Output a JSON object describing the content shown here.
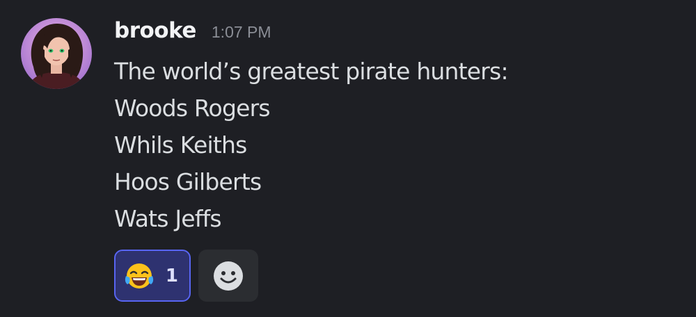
{
  "message": {
    "author": "brooke",
    "timestamp": "1:07 PM",
    "lines": [
      "The world’s greatest pirate hunters:",
      "Woods Rogers",
      "Whils Keiths",
      "Hoos Gilberts",
      "Wats Jeffs"
    ],
    "avatar_icon": "user-avatar"
  },
  "reactions": [
    {
      "emoji": "😂",
      "icon": "face-with-tears-of-joy-icon",
      "count": "1",
      "active": true
    }
  ],
  "add_reaction": {
    "icon": "smiley-face-icon"
  },
  "colors": {
    "background": "#1e1f24",
    "reaction_active_bg": "#2e3270",
    "reaction_active_border": "#5865f2",
    "add_reaction_bg": "#2b2d31"
  }
}
